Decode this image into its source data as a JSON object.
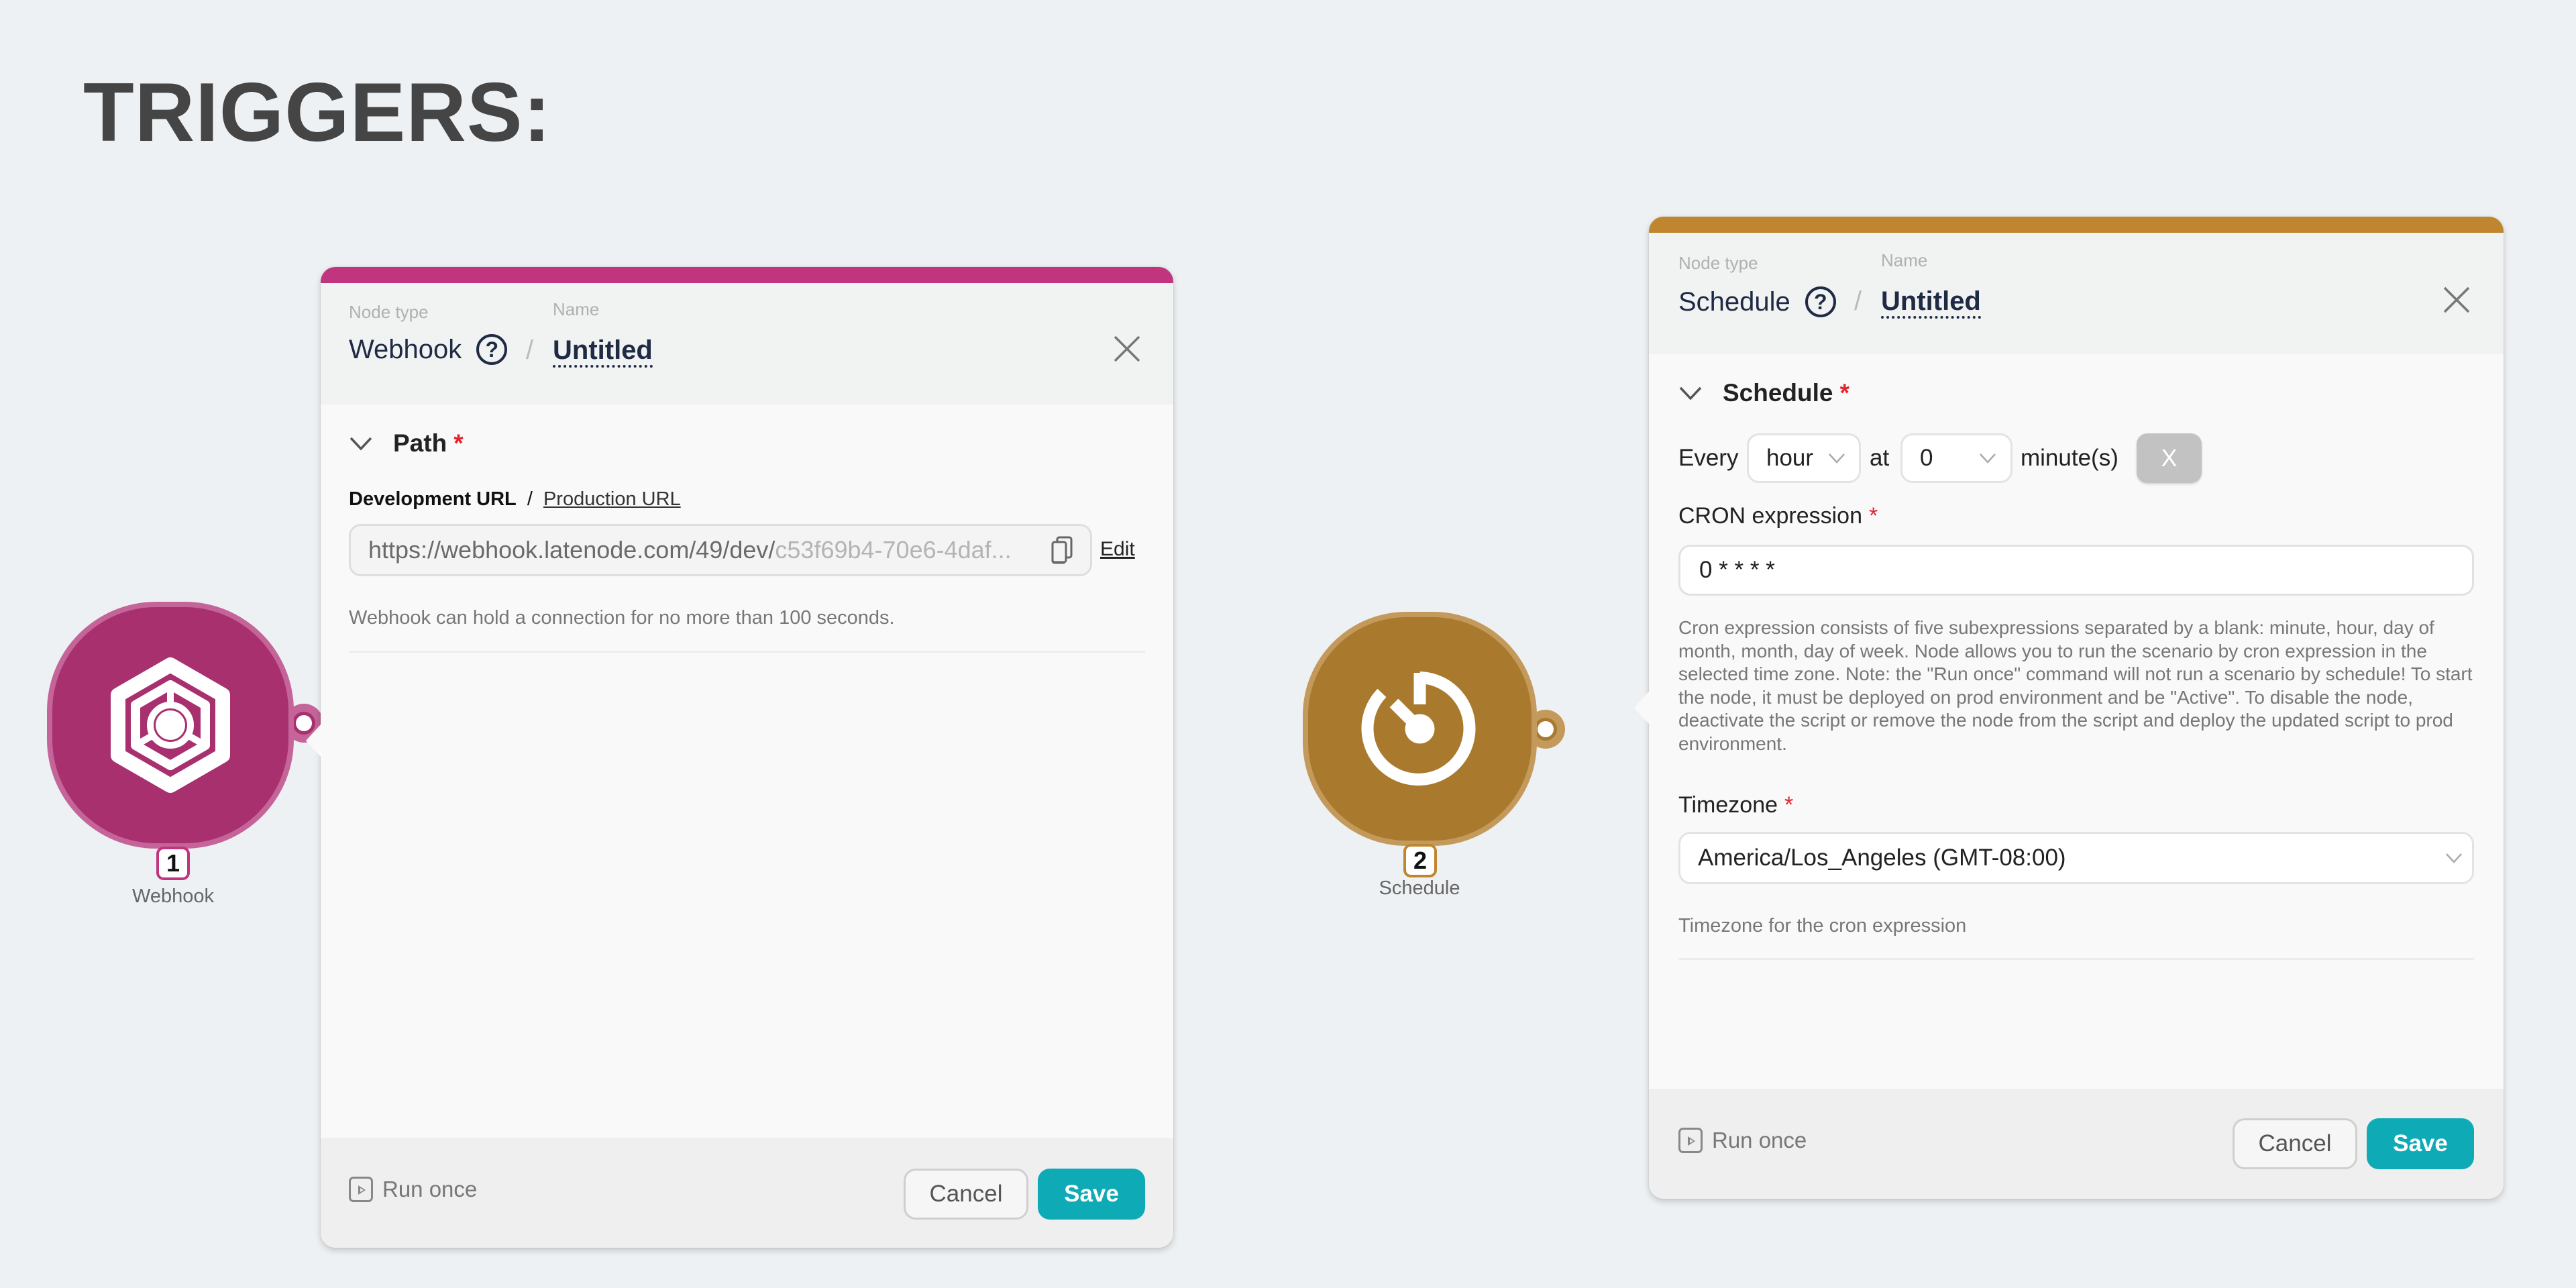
{
  "page": {
    "title": "TRIGGERS:"
  },
  "colors": {
    "webhook_accent": "#c0357e",
    "webhook_node": "#a8306f",
    "schedule_accent": "#c0862f",
    "schedule_node": "#a97a2e",
    "save_button": "#0eaab6",
    "required": "#e4222b"
  },
  "nodes": [
    {
      "number": "1",
      "label": "Webhook",
      "icon": "webhook-hexagon-icon"
    },
    {
      "number": "2",
      "label": "Schedule",
      "icon": "clock-timer-icon"
    }
  ],
  "webhook_panel": {
    "node_type_label": "Node type",
    "name_label": "Name",
    "node_type": "Webhook",
    "separator": "/",
    "name": "Untitled",
    "section_title": "Path",
    "required_mark": "*",
    "url_tab_active": "Development URL",
    "url_tab_separator": "/",
    "url_tab_other": "Production URL",
    "url_value_prefix": "https://webhook.latenode.com/49/dev/",
    "url_value_suffix": "c53f69b4-70e6-4daf...",
    "edit_label": "Edit",
    "hint": "Webhook can hold a connection for no more than 100 seconds.",
    "footer": {
      "run_once": "Run once",
      "cancel": "Cancel",
      "save": "Save"
    }
  },
  "schedule_panel": {
    "node_type_label": "Node type",
    "name_label": "Name",
    "node_type": "Schedule",
    "separator": "/",
    "name": "Untitled",
    "section_title": "Schedule",
    "required_mark": "*",
    "every_label": "Every",
    "interval_value": "hour",
    "at_label": "at",
    "minute_value": "0",
    "minutes_label": "minute(s)",
    "clear_label": "X",
    "cron_label": "CRON expression",
    "cron_value": "0 * * * *",
    "cron_hint": "Cron expression consists of five subexpressions separated by a blank: minute, hour, day of month, month, day of week. Node allows you to run the scenario by cron expression in the selected time zone. Note: the \"Run once\" command will not run a scenario by schedule! To start the node, it must be deployed on prod environment and be \"Active\". To disable the node, deactivate the script or remove the node from the script and deploy the updated script to prod environment.",
    "timezone_label": "Timezone",
    "timezone_value": "America/Los_Angeles (GMT-08:00)",
    "timezone_hint": "Timezone for the cron expression",
    "footer": {
      "run_once": "Run once",
      "cancel": "Cancel",
      "save": "Save"
    }
  }
}
